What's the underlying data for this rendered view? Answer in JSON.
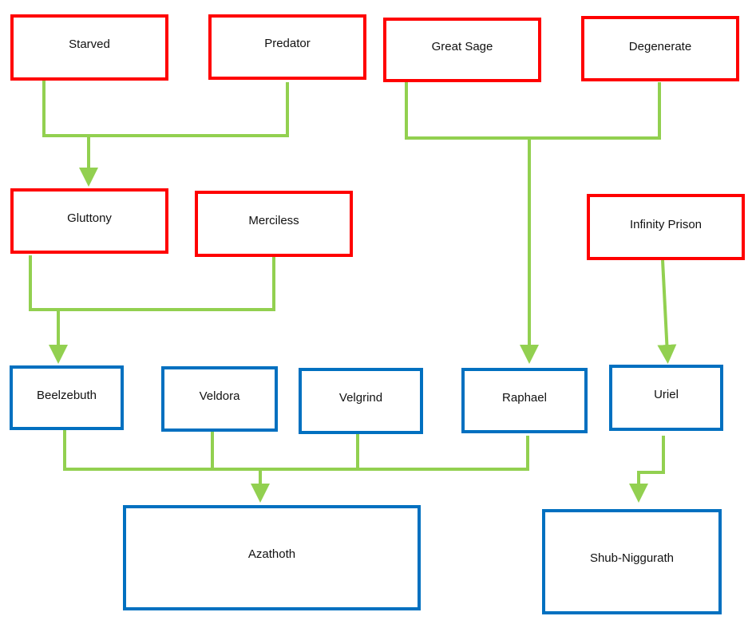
{
  "colors": {
    "skill_border": "#ff0000",
    "entity_border": "#0070c0",
    "connector": "#92d050"
  },
  "nodes": {
    "starved": "Starved",
    "predator": "Predator",
    "great_sage": "Great Sage",
    "degenerate": "Degenerate",
    "gluttony": "Gluttony",
    "merciless": "Merciless",
    "infinity_prison": "Infinity Prison",
    "beelzebuth": "Beelzebuth",
    "veldora": "Veldora",
    "velgrind": "Velgrind",
    "raphael": "Raphael",
    "uriel": "Uriel",
    "azathoth": "Azathoth",
    "shub_niggurath": "Shub-Niggurath"
  }
}
